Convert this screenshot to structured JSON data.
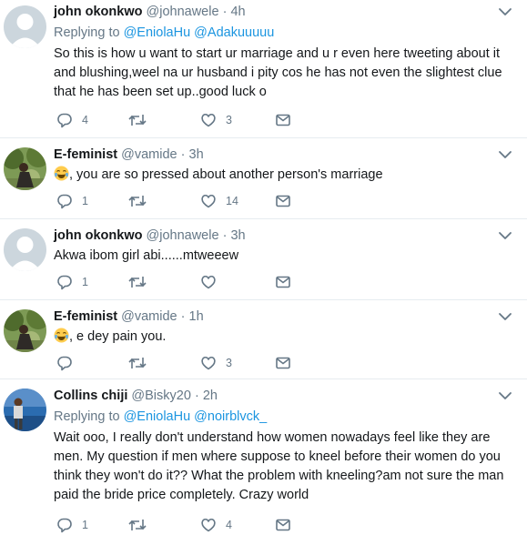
{
  "tweets": [
    {
      "name": "john okonkwo",
      "handle": "@johnawele",
      "dot": "·",
      "time": "4h",
      "reply_prefix": "Replying to",
      "reply_mentions": [
        "@EniolaHu",
        "@Adakuuuuu"
      ],
      "text": "So this is how u want to start ur marriage and u r even here tweeting about it and blushing,weel na ur husband i pity cos he has not even the slightest clue that he has been set up..good luck o",
      "replies": "4",
      "retweets": "",
      "likes": "3"
    },
    {
      "name": "E-feminist",
      "handle": "@vamide",
      "dot": "·",
      "time": "3h",
      "text": ", you are so pressed about another person's marriage",
      "replies": "1",
      "retweets": "",
      "likes": "14"
    },
    {
      "name": "john okonkwo",
      "handle": "@johnawele",
      "dot": "·",
      "time": "3h",
      "text": "Akwa ibom girl abi......mtweeew",
      "replies": "1",
      "retweets": "",
      "likes": ""
    },
    {
      "name": "E-feminist",
      "handle": "@vamide",
      "dot": "·",
      "time": "1h",
      "text": ", e dey pain you.",
      "replies": "",
      "retweets": "",
      "likes": "3"
    },
    {
      "name": "Collins chiji",
      "handle": "@Bisky20",
      "dot": "·",
      "time": "2h",
      "reply_prefix": "Replying to",
      "reply_mentions": [
        "@EniolaHu",
        "@noirblvck_"
      ],
      "text": "Wait ooo, I really don't understand how women nowadays feel like they are men. My question if men where suppose to kneel before their women do you think they won't do it?? What the problem with kneeling?am not sure the man paid the bride price completely. Crazy world",
      "replies": "1",
      "retweets": "",
      "likes": "4"
    }
  ],
  "icons": {
    "caret": "chevron-down-icon",
    "reply": "reply-icon",
    "retweet": "retweet-icon",
    "like": "heart-icon",
    "dm": "envelope-icon",
    "emoji": "face-with-tears-of-joy-emoji"
  },
  "colors": {
    "text": "#14171a",
    "muted": "#657786",
    "link": "#1b95e0",
    "divider": "#e6ecf0"
  }
}
